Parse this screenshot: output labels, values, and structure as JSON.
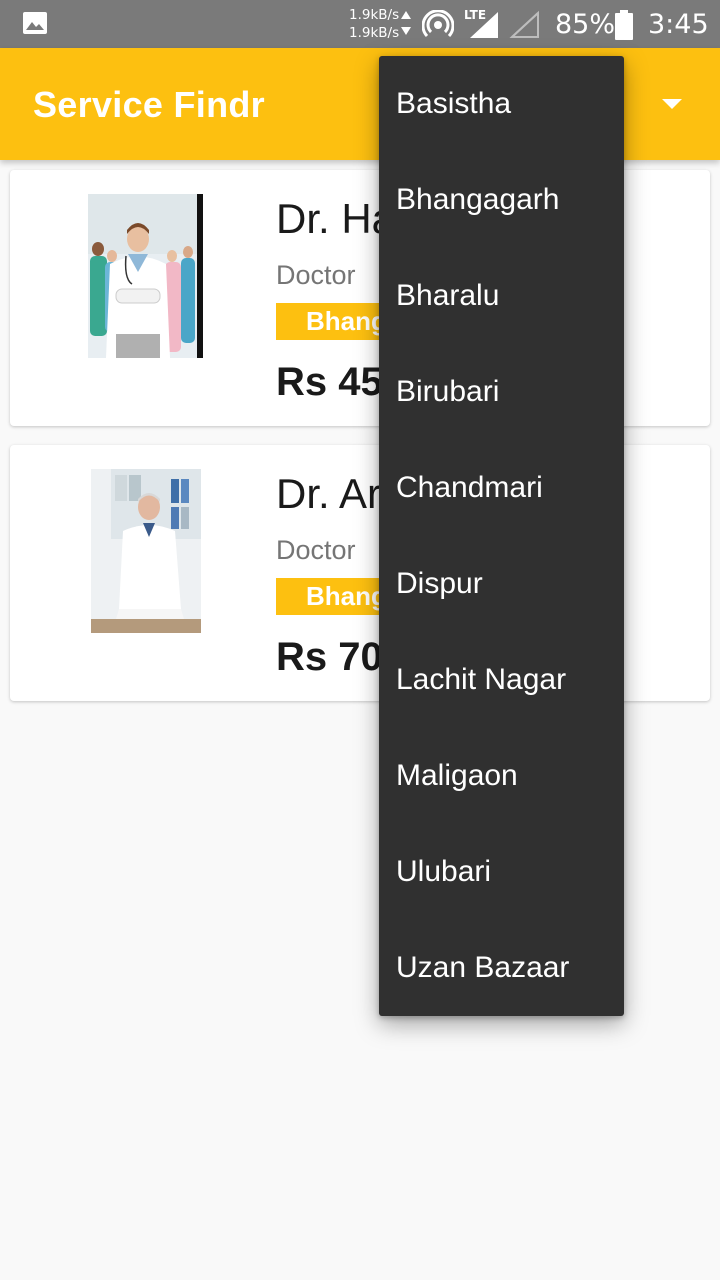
{
  "status_bar": {
    "net_up": "1.9kB/s",
    "net_down": "1.9kB/s",
    "network_type": "LTE",
    "battery": "85%",
    "time": "3:45",
    "icons": [
      "gallery-icon",
      "data-arrows-icon",
      "hotspot-icon",
      "signal-icon",
      "signal-empty-icon",
      "battery-icon"
    ]
  },
  "app_bar": {
    "title": "Service Findr",
    "color": "#fdc010"
  },
  "providers": [
    {
      "name": "Dr. Ha",
      "role": "Doctor",
      "location": "Bhang",
      "price": "Rs 45"
    },
    {
      "name": "Dr. Ar",
      "role": "Doctor",
      "location": "Bhang",
      "price": "Rs 70"
    }
  ],
  "location_menu": {
    "items": [
      "Basistha",
      "Bhangagarh",
      "Bharalu",
      "Birubari",
      "Chandmari",
      "Dispur",
      "Lachit Nagar",
      "Maligaon",
      "Ulubari",
      "Uzan Bazaar"
    ]
  }
}
